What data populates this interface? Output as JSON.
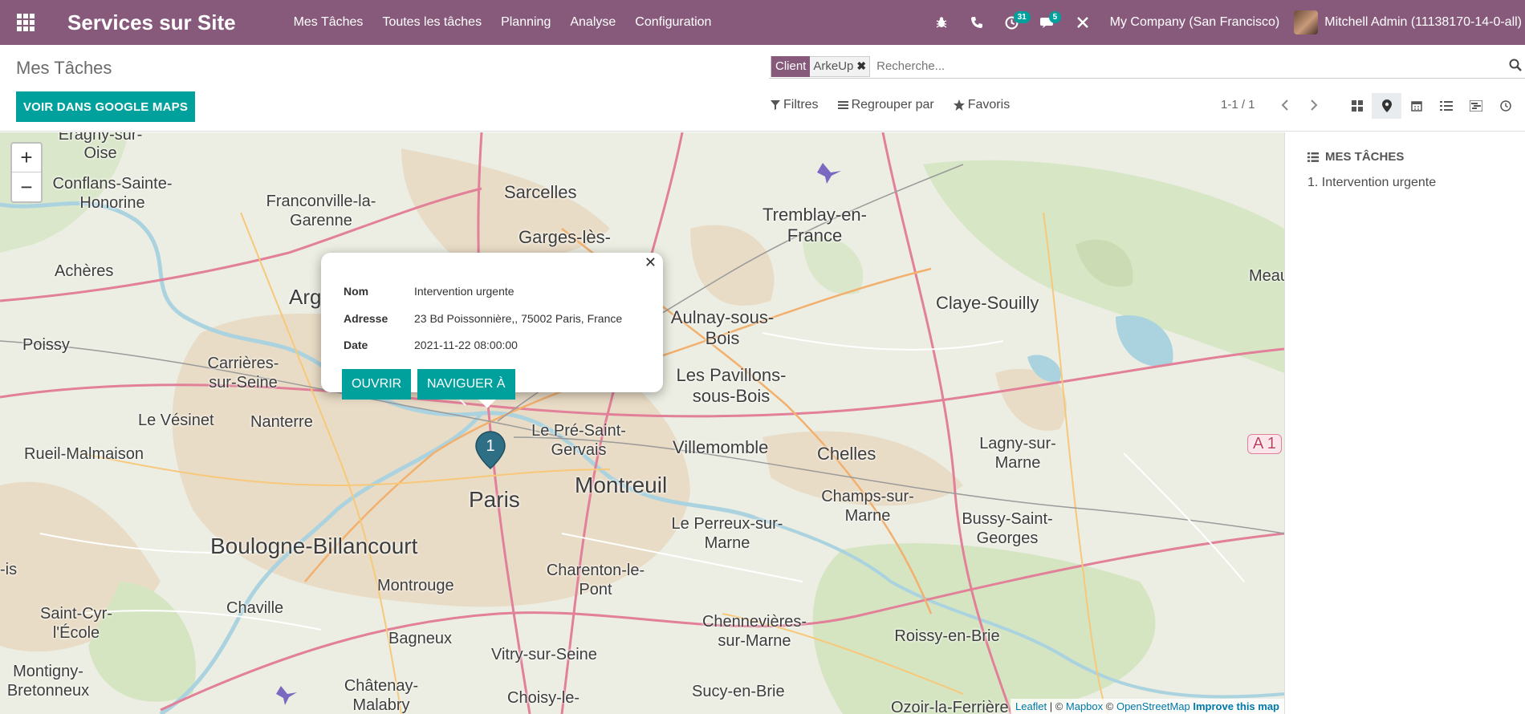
{
  "navbar": {
    "app_title": "Services sur Site",
    "menu": [
      "Mes Tâches",
      "Toutes les tâches",
      "Planning",
      "Analyse",
      "Configuration"
    ],
    "activity_count": "31",
    "messages_count": "5",
    "company": "My Company (San Francisco)",
    "user": "Mitchell Admin (11138170-14-0-all)"
  },
  "control": {
    "breadcrumb": "Mes Tâches",
    "gmaps_button": "VOIR DANS GOOGLE MAPS",
    "search": {
      "facet_label": "Client",
      "facet_value": "ArkeUp",
      "placeholder": "Recherche..."
    },
    "filters_label": "Filtres",
    "groupby_label": "Regrouper par",
    "favorites_label": "Favoris",
    "pager": "1-1 / 1"
  },
  "map": {
    "popup": {
      "name_key": "Nom",
      "name_value": "Intervention urgente",
      "address_key": "Adresse",
      "address_value": "23 Bd Poissonnière,, 75002 Paris, France",
      "date_key": "Date",
      "date_value": "2021-11-22 08:00:00",
      "open_button": "OUVRIR",
      "navigate_button": "NAVIGUER À"
    },
    "marker_number": "1",
    "attribution": {
      "leaflet": "Leaflet",
      "sep1": " | © ",
      "mapbox": "Mapbox",
      "sep2": " © ",
      "osm": "OpenStreetMap",
      "improve": "Improve this map"
    },
    "places": [
      "Eragny-sur-Oise",
      "Conflans-Sainte-Honorine",
      "Franconville-la-Garenne",
      "Sarcelles",
      "Garges-lès-",
      "Tremblay-en-France",
      "Achères",
      "Arg",
      "Aulnay-sous-Bois",
      "Claye-Souilly",
      "Meau",
      "Poissy",
      "Carrières-sur-Seine",
      "Les Pavillons-sous-Bois",
      "Le Vésinet",
      "Nanterre",
      "Le Pré-Saint-Gervais",
      "Villemomble",
      "Chelles",
      "Lagny-sur-Marne",
      "A 1",
      "Rueil-Malmaison",
      "Paris",
      "Montreuil",
      "Champs-sur-Marne",
      "Bussy-Saint-Georges",
      "Boulogne-Billancourt",
      "Le Perreux-sur-Marne",
      "Montrouge",
      "Charenton-le-Pont",
      "Chaville",
      "Saint-Cyr-l'École",
      "Bagneux",
      "Vitry-sur-Seine",
      "Chennevières-sur-Marne",
      "Roissy-en-Brie",
      "Montigny-Bretonneux",
      "Châtenay-Malabry",
      "Choisy-le-",
      "Sucy-en-Brie",
      "Ozoir-la-Ferrière",
      "-is"
    ]
  },
  "sidebar": {
    "title": "MES TÂCHES",
    "items": [
      "1. Intervention urgente"
    ]
  },
  "colors": {
    "navbar": "#875a7b",
    "primary": "#00a09d",
    "marker": "#2e6f86"
  }
}
